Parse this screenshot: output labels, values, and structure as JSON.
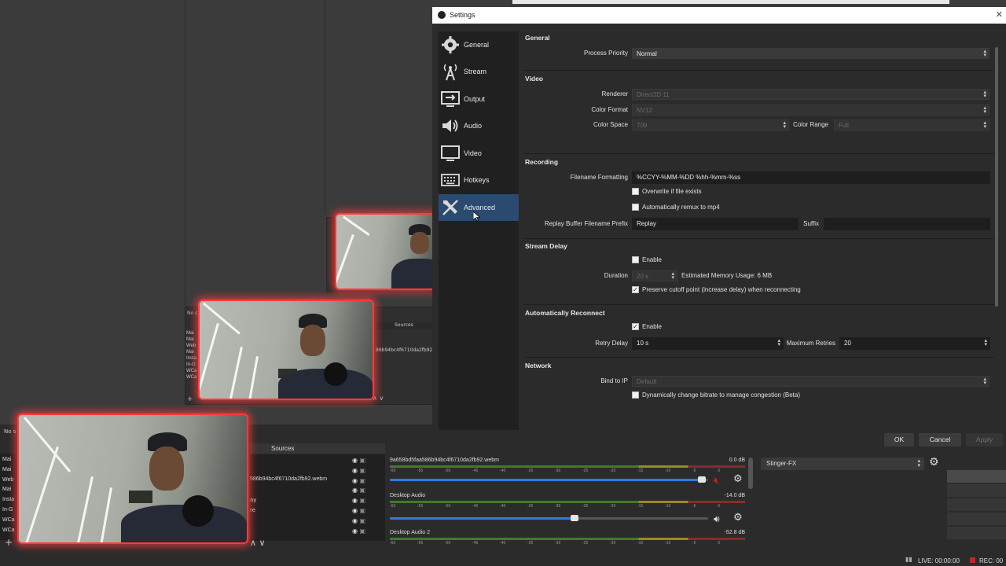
{
  "settings": {
    "title": "Settings",
    "nav": [
      {
        "label": "General",
        "icon": "gear-icon"
      },
      {
        "label": "Stream",
        "icon": "antenna-icon"
      },
      {
        "label": "Output",
        "icon": "output-icon"
      },
      {
        "label": "Audio",
        "icon": "speaker-icon"
      },
      {
        "label": "Video",
        "icon": "monitor-icon"
      },
      {
        "label": "Hotkeys",
        "icon": "keyboard-icon"
      },
      {
        "label": "Advanced",
        "icon": "tools-icon",
        "selected": true
      }
    ],
    "general": {
      "heading": "General",
      "process_priority_label": "Process Priority",
      "process_priority_value": "Normal"
    },
    "video": {
      "heading": "Video",
      "renderer_label": "Renderer",
      "renderer_value": "Direct3D 11",
      "color_format_label": "Color Format",
      "color_format_value": "NV12",
      "color_space_label": "Color Space",
      "color_space_value": "709",
      "color_range_label": "Color Range",
      "color_range_value": "Full"
    },
    "recording": {
      "heading": "Recording",
      "filename_formatting_label": "Filename Formatting",
      "filename_formatting_value": "%CCYY-%MM-%DD %hh-%mm-%ss",
      "overwrite_label": "Overwrite if file exists",
      "overwrite_checked": false,
      "remux_label": "Automatically remux to mp4",
      "remux_checked": false,
      "replay_prefix_label": "Replay Buffer Filename Prefix",
      "replay_prefix_value": "Replay",
      "suffix_label": "Suffix",
      "suffix_value": ""
    },
    "stream_delay": {
      "heading": "Stream Delay",
      "enable_label": "Enable",
      "enable_checked": false,
      "duration_label": "Duration",
      "duration_value": "20 s",
      "memory_usage": "Estimated Memory Usage: 6 MB",
      "preserve_label": "Preserve cutoff point (increase delay) when reconnecting",
      "preserve_checked": true
    },
    "auto_reconnect": {
      "heading": "Automatically Reconnect",
      "enable_label": "Enable",
      "enable_checked": true,
      "retry_delay_label": "Retry Delay",
      "retry_delay_value": "10 s",
      "max_retries_label": "Maximum Retries",
      "max_retries_value": "20"
    },
    "network": {
      "heading": "Network",
      "bind_ip_label": "Bind to IP",
      "bind_ip_value": "Default",
      "dynamic_bitrate_label": "Dynamically change bitrate to manage congestion (Beta)"
    },
    "buttons": {
      "ok": "OK",
      "cancel": "Cancel",
      "apply": "Apply"
    }
  },
  "obs": {
    "sources_title": "Sources",
    "source_file": "586b94bc4f6710da2fb92.webm",
    "bg_sources_title": "Sources",
    "bg_source_file": "86b94bc4f6710da2fb92.w",
    "no_source": "No s",
    "scene_items": [
      "Mai",
      "Mai",
      "Web",
      "Mai",
      "Insta",
      "In-G",
      "WCa",
      "WCa"
    ],
    "scene_items_bg": [
      "Mai",
      "Mai",
      "Web",
      "Mai",
      "Insta",
      "In-G",
      "WCa",
      "WCa"
    ],
    "source_list_fragments": [
      "ay",
      "re"
    ],
    "mixer": [
      {
        "name": "9a658bd5faa586b94bc4f6710da2fb92.webm",
        "db": "0.0 dB",
        "level": 0.98,
        "muted": true
      },
      {
        "name": "Desktop Audio",
        "db": "-14.0 dB",
        "level": 0.58,
        "muted": false
      },
      {
        "name": "Desktop Audio 2",
        "db": "-52.8 dB",
        "level": 0.0,
        "muted": false
      }
    ],
    "meter_ticks": [
      "-60",
      "-55",
      "-50",
      "-45",
      "-40",
      "-35",
      "-30",
      "-25",
      "-20",
      "-15",
      "-10",
      "-5",
      "0"
    ],
    "transition": "Stinger-FX",
    "status_live": "LIVE: 00:00:00",
    "status_rec": "REC: 00"
  },
  "colors": {
    "accent_selected": "#2a4a70",
    "glow": "#ff3b3b",
    "slider_blue": "#2f7ae0",
    "muted_red": "#d02020"
  }
}
